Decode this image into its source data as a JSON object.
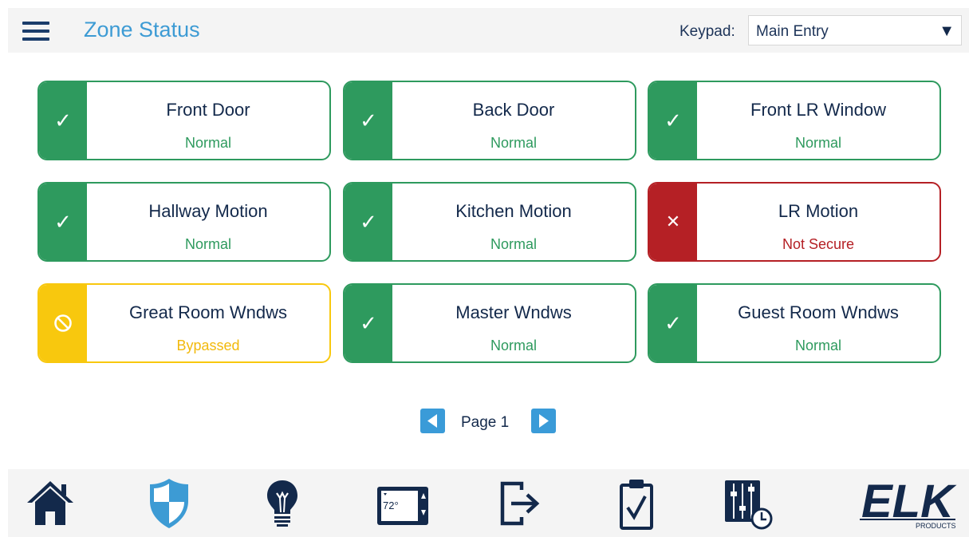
{
  "header": {
    "title": "Zone Status",
    "keypad_label": "Keypad:",
    "keypad_value": "Main Entry"
  },
  "zones": [
    {
      "name": "Front Door",
      "status": "Normal",
      "state": "normal",
      "icon": "checkmark-icon"
    },
    {
      "name": "Back Door",
      "status": "Normal",
      "state": "normal",
      "icon": "checkmark-icon"
    },
    {
      "name": "Front LR Window",
      "status": "Normal",
      "state": "normal",
      "icon": "checkmark-icon"
    },
    {
      "name": "Hallway Motion",
      "status": "Normal",
      "state": "normal",
      "icon": "checkmark-icon"
    },
    {
      "name": "Kitchen Motion",
      "status": "Normal",
      "state": "normal",
      "icon": "checkmark-icon"
    },
    {
      "name": "LR Motion",
      "status": "Not Secure",
      "state": "insecure",
      "icon": "x-icon"
    },
    {
      "name": "Great Room Wndws",
      "status": "Bypassed",
      "state": "bypassed",
      "icon": "prohibited-icon"
    },
    {
      "name": "Master Wndws",
      "status": "Normal",
      "state": "normal",
      "icon": "checkmark-icon"
    },
    {
      "name": "Guest Room Wndws",
      "status": "Normal",
      "state": "normal",
      "icon": "checkmark-icon"
    }
  ],
  "pager": {
    "label": "Page 1"
  },
  "bottom_nav": {
    "thermostat_temp": "72°",
    "brand_text": "ELK",
    "brand_subtext": "PRODUCTS",
    "items": [
      "home-icon",
      "security-shield-icon",
      "lightbulb-icon",
      "thermostat-icon",
      "exit-icon",
      "checklist-icon",
      "automation-schedule-icon",
      "elk-products-logo"
    ]
  },
  "colors": {
    "accent": "#3d9bd4",
    "navy": "#13294b",
    "normal": "#2e9a5e",
    "not_secure": "#b52025",
    "bypassed": "#f8c80e"
  }
}
